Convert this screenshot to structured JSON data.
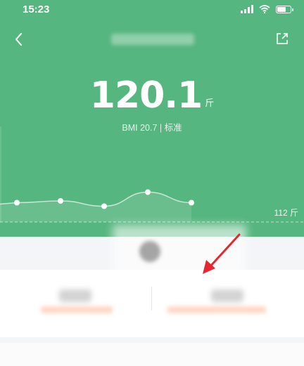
{
  "status_bar": {
    "time": "15:23"
  },
  "weight": {
    "value": "120.1",
    "unit": "斤"
  },
  "bmi_text": "BMI 20.7 | 标准",
  "reference_label": "112 斤",
  "chart_data": {
    "type": "line",
    "title": "",
    "xlabel": "",
    "ylabel": "",
    "x": [
      1,
      2,
      3,
      4,
      5
    ],
    "series": [
      {
        "values": [
          119.9,
          120.0,
          119.7,
          120.5,
          119.9
        ]
      }
    ],
    "reference_line": 112,
    "grid": false
  },
  "colors": {
    "header_green": "#56b67f",
    "annotation_arrow": "#e8262d",
    "panel_bg": "#f4f5f7"
  },
  "icons": {
    "back": "chevron-left-icon",
    "share": "share-icon",
    "wifi": "wifi-icon",
    "signal": "signal-icon",
    "battery": "battery-icon"
  }
}
